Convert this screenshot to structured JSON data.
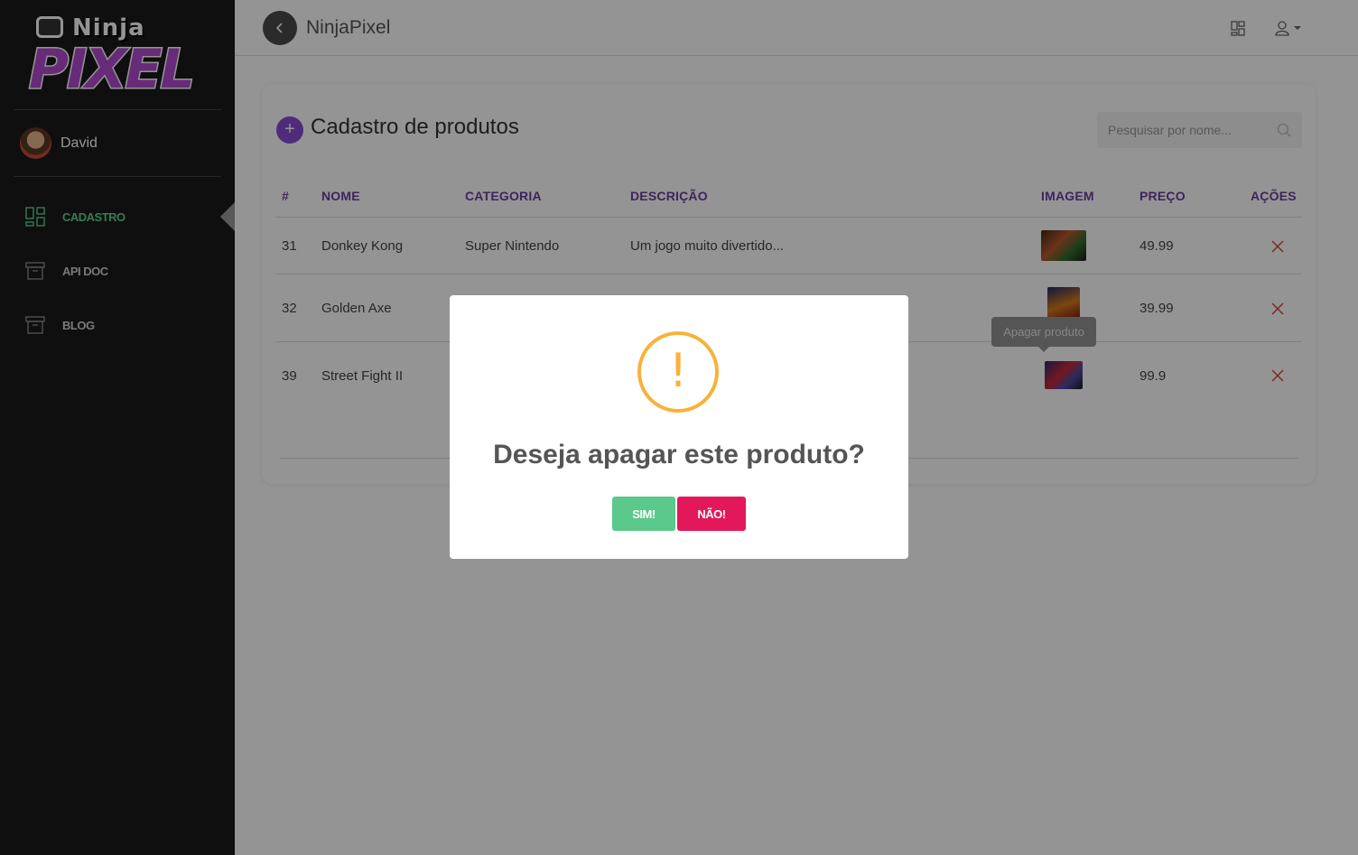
{
  "brand": {
    "logo_top": "Ninja",
    "logo_bottom": "PIXEL"
  },
  "user": {
    "name": "David"
  },
  "sidebar": {
    "items": [
      {
        "label": "CADASTRO",
        "icon": "dashboard-icon",
        "active": true
      },
      {
        "label": "API DOC",
        "icon": "archive-icon",
        "active": false
      },
      {
        "label": "BLOG",
        "icon": "archive-icon",
        "active": false
      }
    ]
  },
  "topbar": {
    "title": "NinjaPixel"
  },
  "page": {
    "title": "Cadastro de produtos",
    "search_placeholder": "Pesquisar por nome...",
    "columns": [
      "#",
      "NOME",
      "CATEGORIA",
      "DESCRIÇÃO",
      "IMAGEM",
      "PREÇO",
      "AÇÕES"
    ],
    "rows": [
      {
        "id": "31",
        "nome": "Donkey Kong",
        "categoria": "Super Nintendo",
        "descricao": "Um jogo muito divertido...",
        "preco": "49.99"
      },
      {
        "id": "32",
        "nome": "Golden Axe",
        "categoria": "",
        "descricao": "",
        "preco": "39.99"
      },
      {
        "id": "39",
        "nome": "Street Fight II",
        "categoria": "",
        "descricao": "",
        "preco": "99.9"
      }
    ],
    "tooltip": "Apagar produto"
  },
  "modal": {
    "icon": "warning-icon",
    "symbol": "!",
    "title": "Deseja apagar este produto?",
    "confirm_label": "SIM!",
    "cancel_label": "NÃO!"
  },
  "colors": {
    "accent": "#6b3fa0",
    "active_nav": "#5fd497",
    "danger": "#e3185a",
    "success": "#5bc88c",
    "warning": "#f8b23a"
  }
}
